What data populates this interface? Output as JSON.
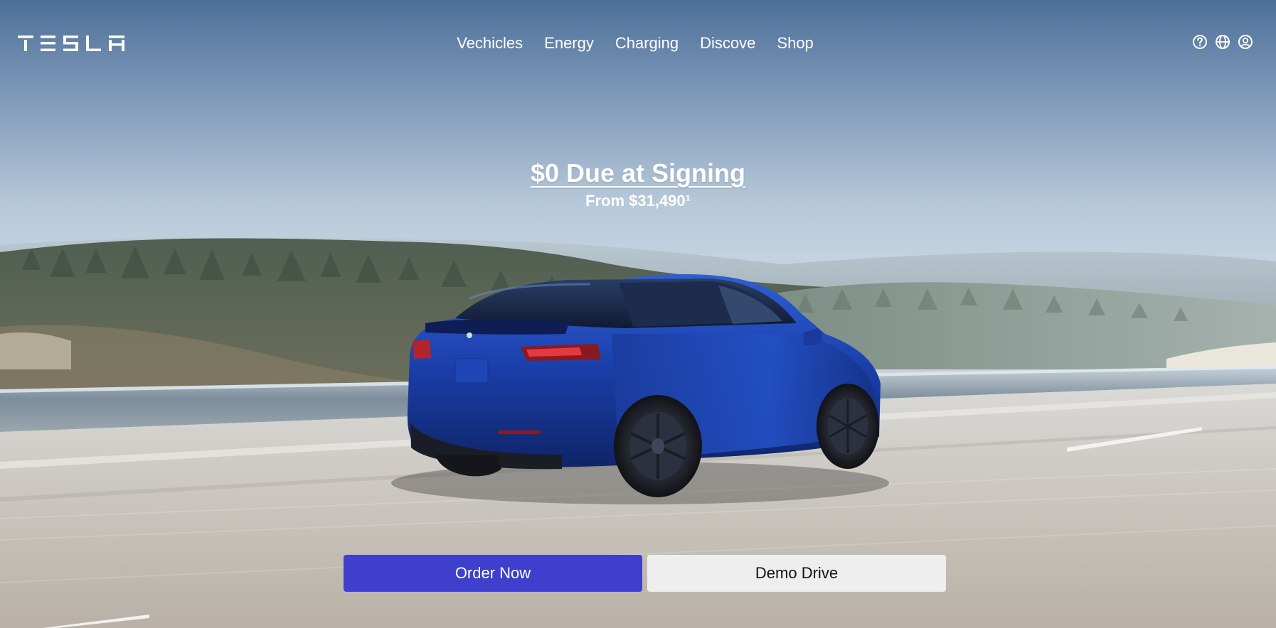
{
  "brand": {
    "logo_text": "TESLA"
  },
  "nav": {
    "items": [
      {
        "label": "Vechicles"
      },
      {
        "label": "Energy"
      },
      {
        "label": "Charging"
      },
      {
        "label": "Discove"
      },
      {
        "label": "Shop"
      }
    ]
  },
  "header_icons": [
    "help-icon",
    "globe-icon",
    "account-icon"
  ],
  "hero": {
    "title": "$0 Due at Signing",
    "subtitle": "From $31,490¹"
  },
  "buttons": {
    "primary_label": "Order Now",
    "secondary_label": "Demo Drive"
  },
  "colors": {
    "primary_button": "#3e3fcc",
    "secondary_button": "#eeeeee",
    "car_paint": "#1c3fb0"
  }
}
